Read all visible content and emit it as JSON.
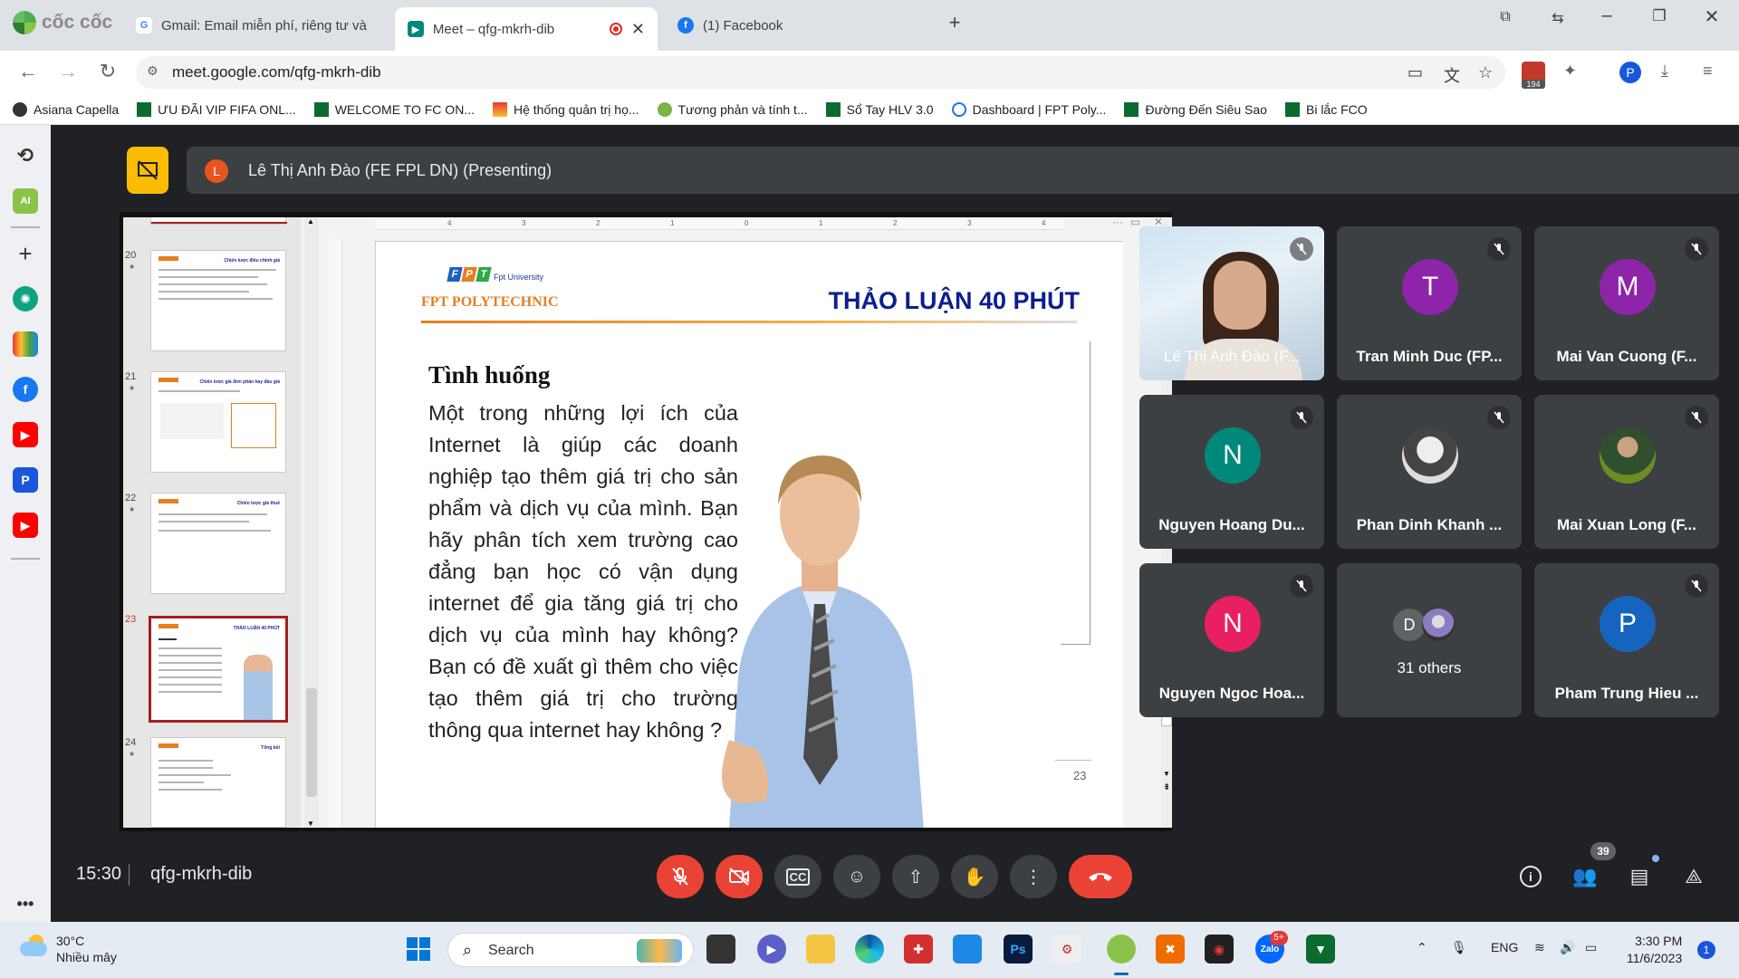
{
  "browser": {
    "brand": "cốc cốc",
    "tabs": [
      {
        "label": "Gmail: Email miễn phí, riêng tư và bả",
        "icon": "google-icon"
      },
      {
        "label": "Meet – qfg-mkrh-dib",
        "icon": "google-meet-icon",
        "active": true
      },
      {
        "label": "(1) Facebook",
        "icon": "facebook-icon"
      }
    ],
    "url": "meet.google.com/qfg-mkrh-dib",
    "extension_badge": "194",
    "profile_initial": "P",
    "bookmarks": [
      "Asiana Capella",
      "ƯU ĐÃI VIP FIFA ONL...",
      "WELCOME TO FC ON...",
      "Hệ thống quản trị họ...",
      "Tương phản và tính t...",
      "Sổ Tay HLV 3.0",
      "Dashboard | FPT Poly...",
      "Đường Đến Siêu Sao",
      "Bi lắc FCO"
    ]
  },
  "meet": {
    "presenter": {
      "initial": "L",
      "label": "Lê Thị Anh Đào (FE FPL DN) (Presenting)"
    },
    "slide": {
      "logo_text": "FPT",
      "university": "Fpt University",
      "school": "FPT POLYTECHNIC",
      "heading": "THẢO LUẬN 40 PHÚT",
      "subheading": "Tình huống",
      "body": "Một trong những lợi ích của Internet là giúp các doanh nghiệp tạo thêm giá trị cho sản phẩm và dịch vụ của mình. Bạn hãy phân tích xem trường cao đẳng bạn học có vận dụng internet để gia tăng giá trị cho dịch vụ của mình hay không? Bạn có đề xuất gì thêm cho việc tạo thêm giá trị cho trường thông qua internet hay không ?",
      "page_number": "23"
    },
    "thumbnails": [
      {
        "num": "20",
        "title": "Chiến lược điều chỉnh giá"
      },
      {
        "num": "21",
        "title": "Chiến lược giá đơn phân hay đầu giá"
      },
      {
        "num": "22",
        "title": "Chiến lược giá thuê"
      },
      {
        "num": "23",
        "title": "THẢO LUẬN 40 PHÚT",
        "selected": true
      },
      {
        "num": "24",
        "title": "Tổng kết"
      }
    ],
    "ruler_numbers": [
      "4",
      "3",
      "2",
      "1",
      "0",
      "1",
      "2",
      "3",
      "4"
    ],
    "participants": [
      {
        "name": "Lê Thị Anh Đào (F...",
        "photo": true
      },
      {
        "name": "Tran Minh Duc (FP...",
        "initial": "T",
        "color": "#8e24aa"
      },
      {
        "name": "Mai Van Cuong (F...",
        "initial": "M",
        "color": "#8e24aa"
      },
      {
        "name": "Nguyen Hoang Du...",
        "initial": "N",
        "color": "#00897b"
      },
      {
        "name": "Phan Dinh Khanh ...",
        "initial": "",
        "color": "#6d6d6d"
      },
      {
        "name": "Mai Xuan Long (F...",
        "initial": "",
        "color": "#556b2f"
      },
      {
        "name": "Nguyen Ngoc Hoa...",
        "initial": "N",
        "color": "#e91e63"
      },
      {
        "name": "31 others",
        "initial": "D",
        "color": "#5f6368",
        "others": true
      },
      {
        "name": "Pham Trung Hieu ...",
        "initial": "P",
        "color": "#1565c0"
      }
    ],
    "time": "15:30",
    "meeting_code": "qfg-mkrh-dib",
    "people_count": "39"
  },
  "taskbar": {
    "weather_temp": "30°C",
    "weather_desc": "Nhiều mây",
    "search_label": "Search",
    "language": "ENG",
    "clock_time": "3:30 PM",
    "clock_date": "11/6/2023",
    "notifications": "1",
    "zalo_badge": "5+"
  }
}
